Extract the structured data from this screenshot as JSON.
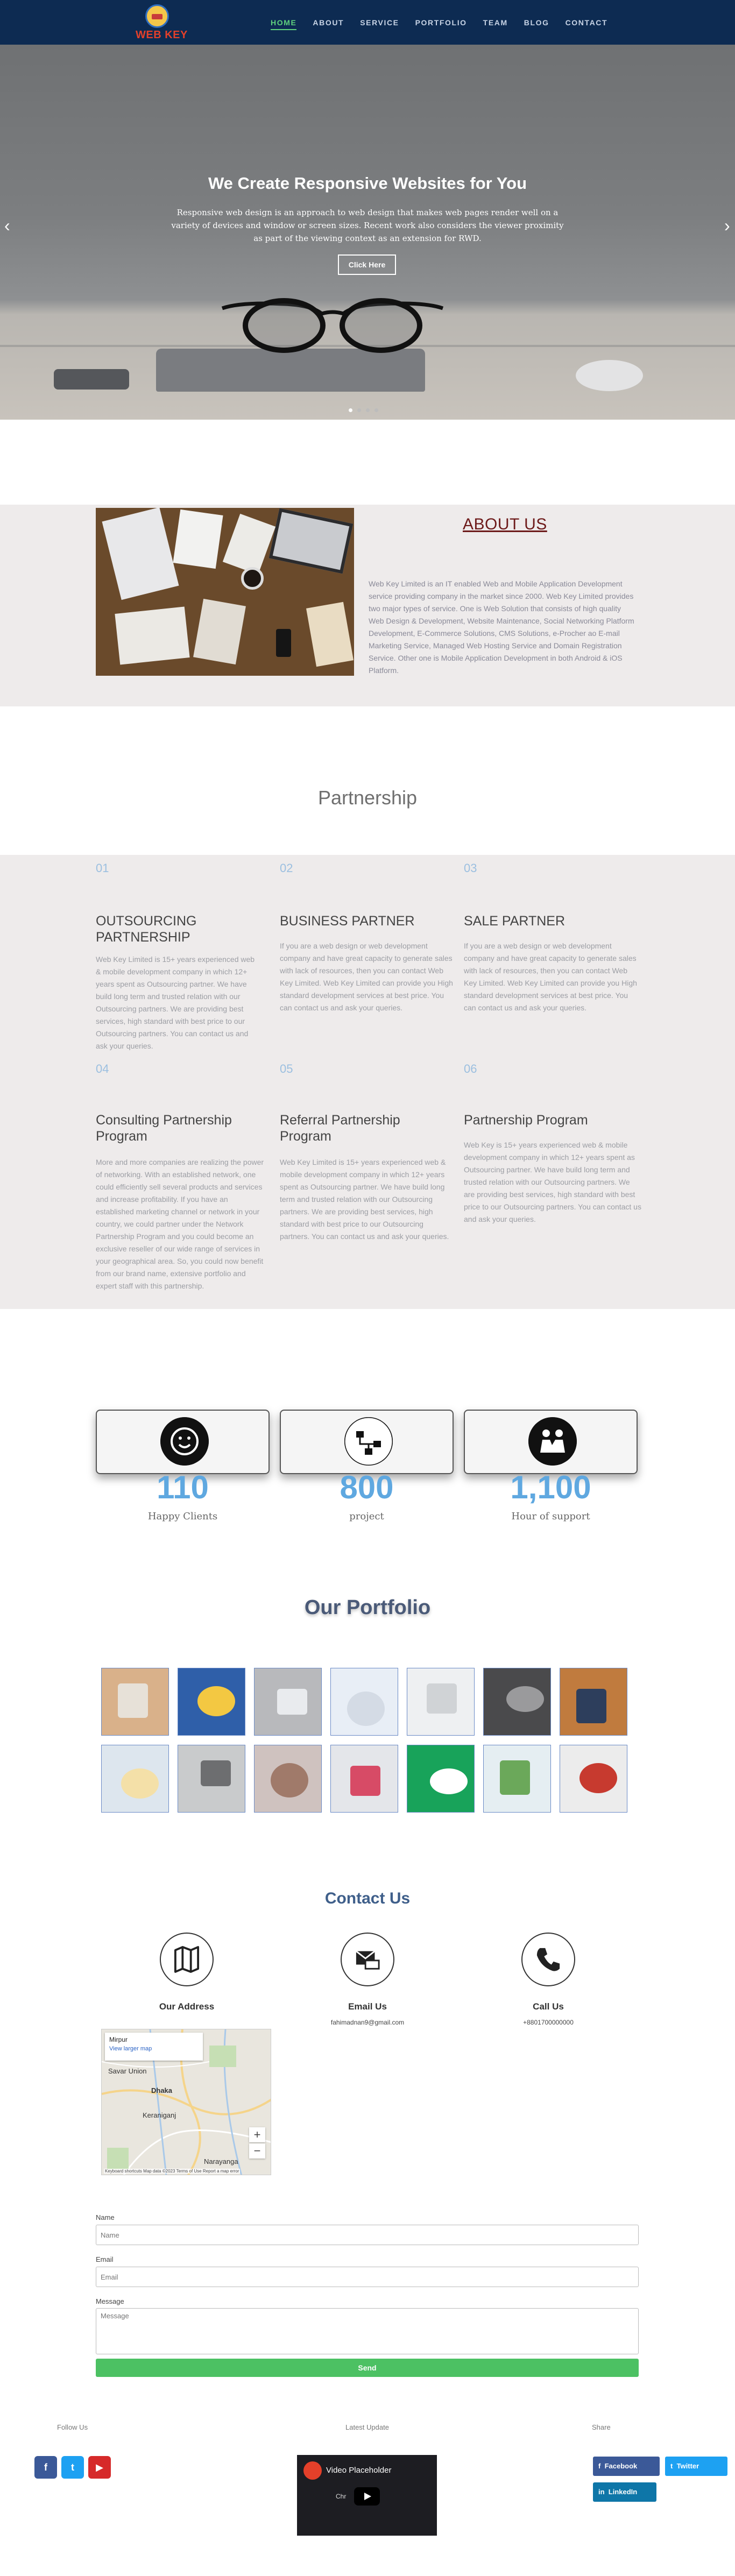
{
  "brand": {
    "logo_text": "WEB KEY"
  },
  "nav": [
    "HOME",
    "ABOUT",
    "SERVICE",
    "PORTFOLIO",
    "TEAM",
    "BLOG",
    "CONTACT"
  ],
  "hero": {
    "title": "We Create Responsive Websites for You",
    "text": "Responsive web design is an approach to web design that makes web pages render well on a variety of devices and window or screen sizes. Recent work also considers the viewer proximity as part of the viewing context as an extension for RWD.",
    "button": "Click Here",
    "prev": "‹",
    "next": "›"
  },
  "about": {
    "title": "ABOUT US",
    "text": "Web Key Limited is an IT enabled Web and Mobile Application Development service providing company in the market since 2000. Web Key Limited provides two major types of service. One is Web Solution that consists of high quality Web Design & Development, Website Maintenance, Social Networking Platform Development, E-Commerce Solutions, CMS Solutions, e-Procher ao E-mail Marketing Service, Managed Web Hosting Service and Domain Registration Service. Other one is Mobile Application Development in both Android & iOS Platform."
  },
  "partnership": {
    "title": "Partnership",
    "items": [
      {
        "num": "01",
        "title": "OUTSOURCING PARTNERSHIP",
        "text": "Web Key Limited is 15+ years experienced web & mobile development company in which 12+ years spent as Outsourcing partner. We have build long term and trusted relation with our Outsourcing partners. We are providing best services, high standard with best price to our Outsourcing partners. You can contact us and ask your queries."
      },
      {
        "num": "02",
        "title": "BUSINESS PARTNER",
        "text": "If you are a web design or web development company and have great capacity to generate sales with lack of resources, then you can contact Web Key Limited. Web Key Limited can provide you High standard development services at best price. You can contact us and ask your queries."
      },
      {
        "num": "03",
        "title": "SALE PARTNER",
        "text": "If you are a web design or web development company and have great capacity to generate sales with lack of resources, then you can contact Web Key Limited. Web Key Limited can provide you High standard development services at best price. You can contact us and ask your queries."
      },
      {
        "num": "04",
        "title": "Consulting Partnership Program",
        "text": "More and more companies are realizing the power of networking. With an established network, one could efficiently sell several products and services and increase profitability. If you have an established marketing channel or network in your country, we could partner under the Network Partnership Program and you could become an exclusive reseller of our wide range of services in your geographical area. So, you could now benefit from our brand name, extensive portfolio and expert staff with this partnership."
      },
      {
        "num": "05",
        "title": "Referral Partnership Program",
        "text": "Web Key Limited is 15+ years experienced web & mobile development company in which 12+ years spent as Outsourcing partner. We have build long term and trusted relation with our Outsourcing partners. We are providing best services, high standard with best price to our Outsourcing partners. You can contact us and ask your queries."
      },
      {
        "num": "06",
        "title": "Partnership Program",
        "text": "Web Key is 15+ years experienced web & mobile development company in which 12+ years spent as Outsourcing partner. We have build long term and trusted relation with our Outsourcing partners. We are providing best services, high standard with best price to our Outsourcing partners. You can contact us and ask your queries."
      }
    ]
  },
  "stats": [
    {
      "icon": "smiley-icon",
      "value": "110",
      "label": "Happy Clients"
    },
    {
      "icon": "diagram-icon",
      "value": "800",
      "label": "project"
    },
    {
      "icon": "people-icon",
      "value": "1,100",
      "label": "Hour of support"
    }
  ],
  "portfolio": {
    "title": "Our Portfolio",
    "thumbs": [
      {
        "bg": "#d9b18a",
        "obj": "#e7e1d8"
      },
      {
        "bg": "#2f5fa9",
        "obj": "#f3c842"
      },
      {
        "bg": "#b8b9bc",
        "obj": "#e9ebee"
      },
      {
        "bg": "#e8eef6",
        "obj": "#d4dbe5"
      },
      {
        "bg": "#eef0f2",
        "obj": "#d0d3d6"
      },
      {
        "bg": "#4a4a4c",
        "obj": "#9a9a9c"
      },
      {
        "bg": "#c07b3e",
        "obj": "#2d3e5c"
      },
      {
        "bg": "#dde6ee",
        "obj": "#f4e0a8"
      },
      {
        "bg": "#c9cbcc",
        "obj": "#6d6e70"
      },
      {
        "bg": "#cfc2bf",
        "obj": "#a07a6a"
      },
      {
        "bg": "#e4e6ea",
        "obj": "#d74b66"
      },
      {
        "bg": "#18a35a",
        "obj": "#ffffff"
      },
      {
        "bg": "#e5eef2",
        "obj": "#6ba85a"
      },
      {
        "bg": "#ececec",
        "obj": "#c73a2f"
      }
    ]
  },
  "contact": {
    "title": "Contact Us",
    "blocks": [
      {
        "icon": "map-icon",
        "title": "Our Address",
        "value": ""
      },
      {
        "icon": "email-icon",
        "title": "Email Us",
        "value": "fahimadnan9@gmail.com"
      },
      {
        "icon": "phone-icon",
        "title": "Call Us",
        "value": "+8801700000000"
      }
    ],
    "map": {
      "place": "Mirpur",
      "link": "View larger map",
      "labels": [
        "Savar Union",
        "Dhaka",
        "Keraniganj",
        "Narayanga"
      ],
      "zoom_in": "+",
      "zoom_out": "−",
      "footer": "Keyboard shortcuts   Map data ©2023   Terms of Use   Report a map error"
    },
    "form": {
      "name_label": "Name",
      "name_placeholder": "Name",
      "email_label": "Email",
      "email_placeholder": "Email",
      "message_label": "Message",
      "message_placeholder": "Message",
      "send": "Send"
    }
  },
  "footer": {
    "follow_label": "Follow Us",
    "update_label": "Latest Update",
    "share_label": "Share",
    "social": [
      {
        "icon": "facebook-icon",
        "glyph": "f",
        "color": "#3b5998"
      },
      {
        "icon": "twitter-icon",
        "glyph": "t",
        "color": "#1da1f2"
      },
      {
        "icon": "youtube-icon",
        "glyph": "▶",
        "color": "#d62a2a"
      }
    ],
    "video_title": "Video Placeholder",
    "video_watch": "Chr",
    "share_buttons": [
      {
        "label": "Facebook",
        "color": "#3b5998"
      },
      {
        "label": "Twitter",
        "color": "#1da1f2"
      },
      {
        "label": "LinkedIn",
        "color": "#0e76a8"
      }
    ]
  }
}
